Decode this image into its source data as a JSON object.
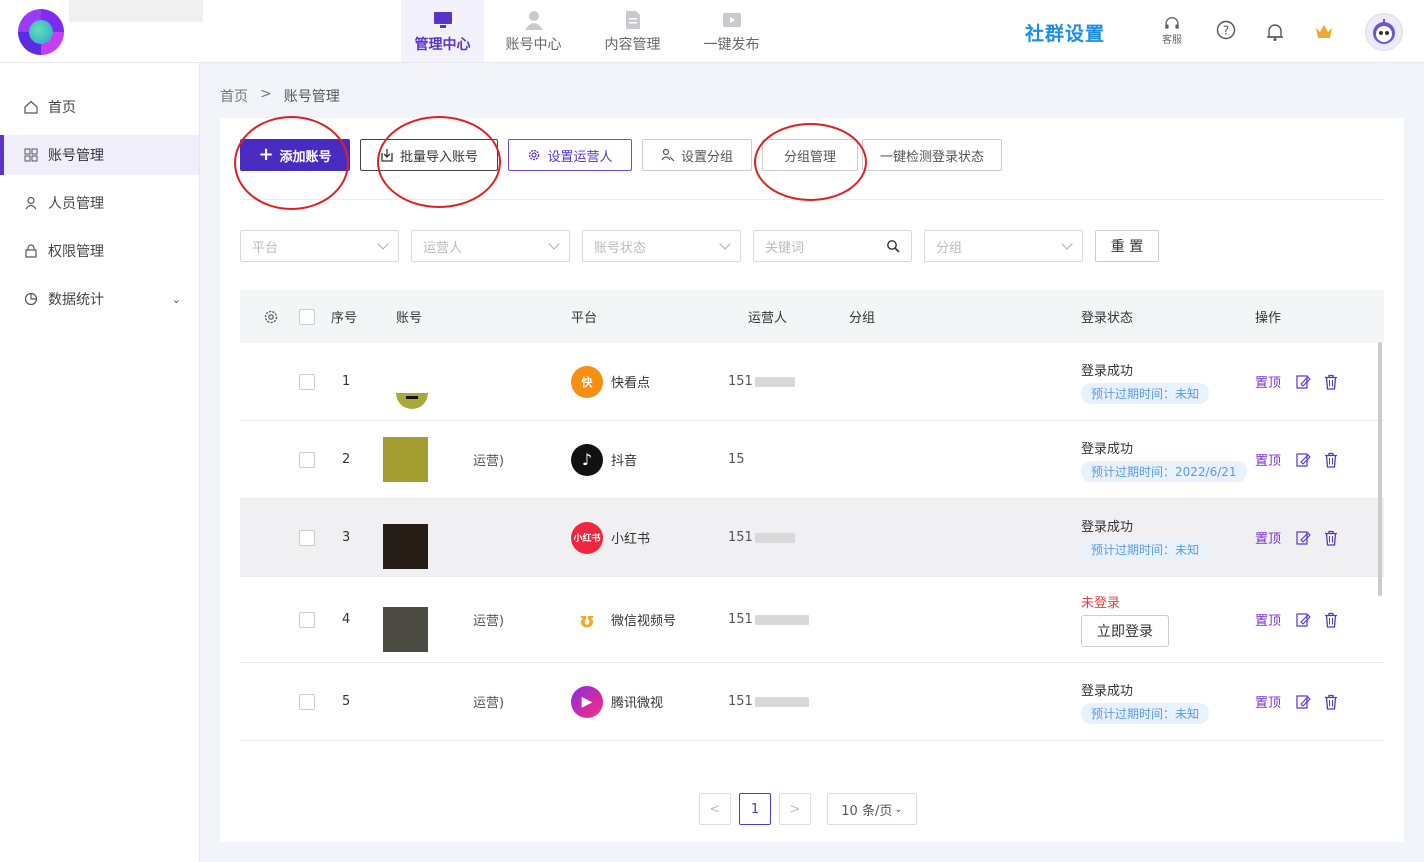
{
  "header": {
    "nav": [
      {
        "label": "管理中心",
        "active": true,
        "icon": "monitor-icon"
      },
      {
        "label": "账号中心",
        "active": false,
        "icon": "user-icon"
      },
      {
        "label": "内容管理",
        "active": false,
        "icon": "document-icon"
      },
      {
        "label": "一键发布",
        "active": false,
        "icon": "video-icon"
      }
    ],
    "community_label": "社群设置",
    "kefu_label": "客服"
  },
  "sidebar": {
    "items": [
      {
        "label": "首页",
        "icon": "home-icon",
        "active": false
      },
      {
        "label": "账号管理",
        "icon": "grid-icon",
        "active": true
      },
      {
        "label": "人员管理",
        "icon": "person-icon",
        "active": false
      },
      {
        "label": "权限管理",
        "icon": "lock-icon",
        "active": false
      },
      {
        "label": "数据统计",
        "icon": "chart-icon",
        "active": false
      }
    ]
  },
  "breadcrumb": {
    "home": "首页",
    "sep": ">",
    "current": "账号管理"
  },
  "toolbar": {
    "add_account": "添加账号",
    "bulk_import": "批量导入账号",
    "set_operator": "设置运营人",
    "set_group": "设置分组",
    "group_manage": "分组管理",
    "check_login": "一键检测登录状态"
  },
  "filters": {
    "platform": "平台",
    "operator": "运营人",
    "account_status": "账号状态",
    "keyword": "关键词",
    "group": "分组",
    "reset": "重 置"
  },
  "table": {
    "headers": {
      "index": "序号",
      "account": "账号",
      "platform": "平台",
      "operator": "运营人",
      "group": "分组",
      "login_status": "登录状态",
      "actions": "操作"
    },
    "rows": [
      {
        "index": "1",
        "account_suffix": "",
        "platform": "快看点",
        "platform_icon": "kuaikandian-icon",
        "operator": "151",
        "status": "登录成功",
        "expire": "预计过期时间：未知",
        "logged_in": true
      },
      {
        "index": "2",
        "account_suffix": "运营)",
        "platform": "抖音",
        "platform_icon": "douyin-icon",
        "operator": "15",
        "status": "登录成功",
        "expire": "预计过期时间：2022/6/21",
        "logged_in": true
      },
      {
        "index": "3",
        "account_suffix": "",
        "platform": "小红书",
        "platform_icon": "xiaohongshu-icon",
        "operator": "151",
        "status": "登录成功",
        "expire": "预计过期时间：未知",
        "logged_in": true
      },
      {
        "index": "4",
        "account_suffix": "运营)",
        "platform": "微信视频号",
        "platform_icon": "wechat-channels-icon",
        "operator": "151",
        "status": "未登录",
        "login_now": "立即登录",
        "logged_in": false
      },
      {
        "index": "5",
        "account_suffix": "运营)",
        "platform": "腾讯微视",
        "platform_icon": "weishi-icon",
        "operator": "151",
        "status": "登录成功",
        "expire": "预计过期时间：未知",
        "logged_in": true
      }
    ],
    "pin_label": "置顶"
  },
  "pagination": {
    "current": "1",
    "page_size": "10 条/页"
  },
  "colors": {
    "accent": "#4a2bc2",
    "brand_blue": "#1d8ee6",
    "error": "#e54545",
    "annotation": "#e02020"
  }
}
